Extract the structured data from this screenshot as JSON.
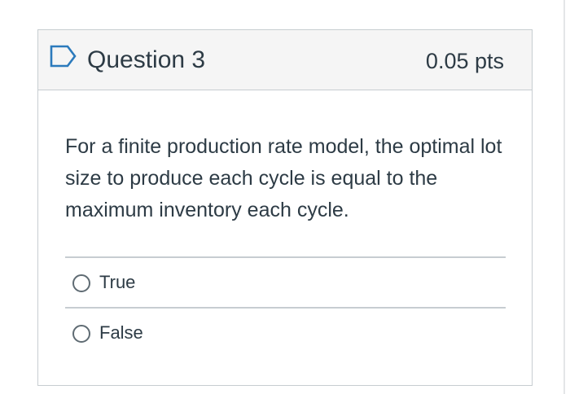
{
  "question": {
    "title": "Question 3",
    "points": "0.05 pts",
    "flag_icon": "flag-outline-icon",
    "text": "For a finite production rate model, the optimal lot size to produce each cycle is equal to the maximum inventory each cycle.",
    "answers": [
      {
        "label": "True",
        "selected": false
      },
      {
        "label": "False",
        "selected": false
      }
    ]
  },
  "colors": {
    "text": "#2d3b45",
    "border": "#c7cdd1",
    "header_bg": "#f5f5f5",
    "flag": "#2b7abc"
  }
}
